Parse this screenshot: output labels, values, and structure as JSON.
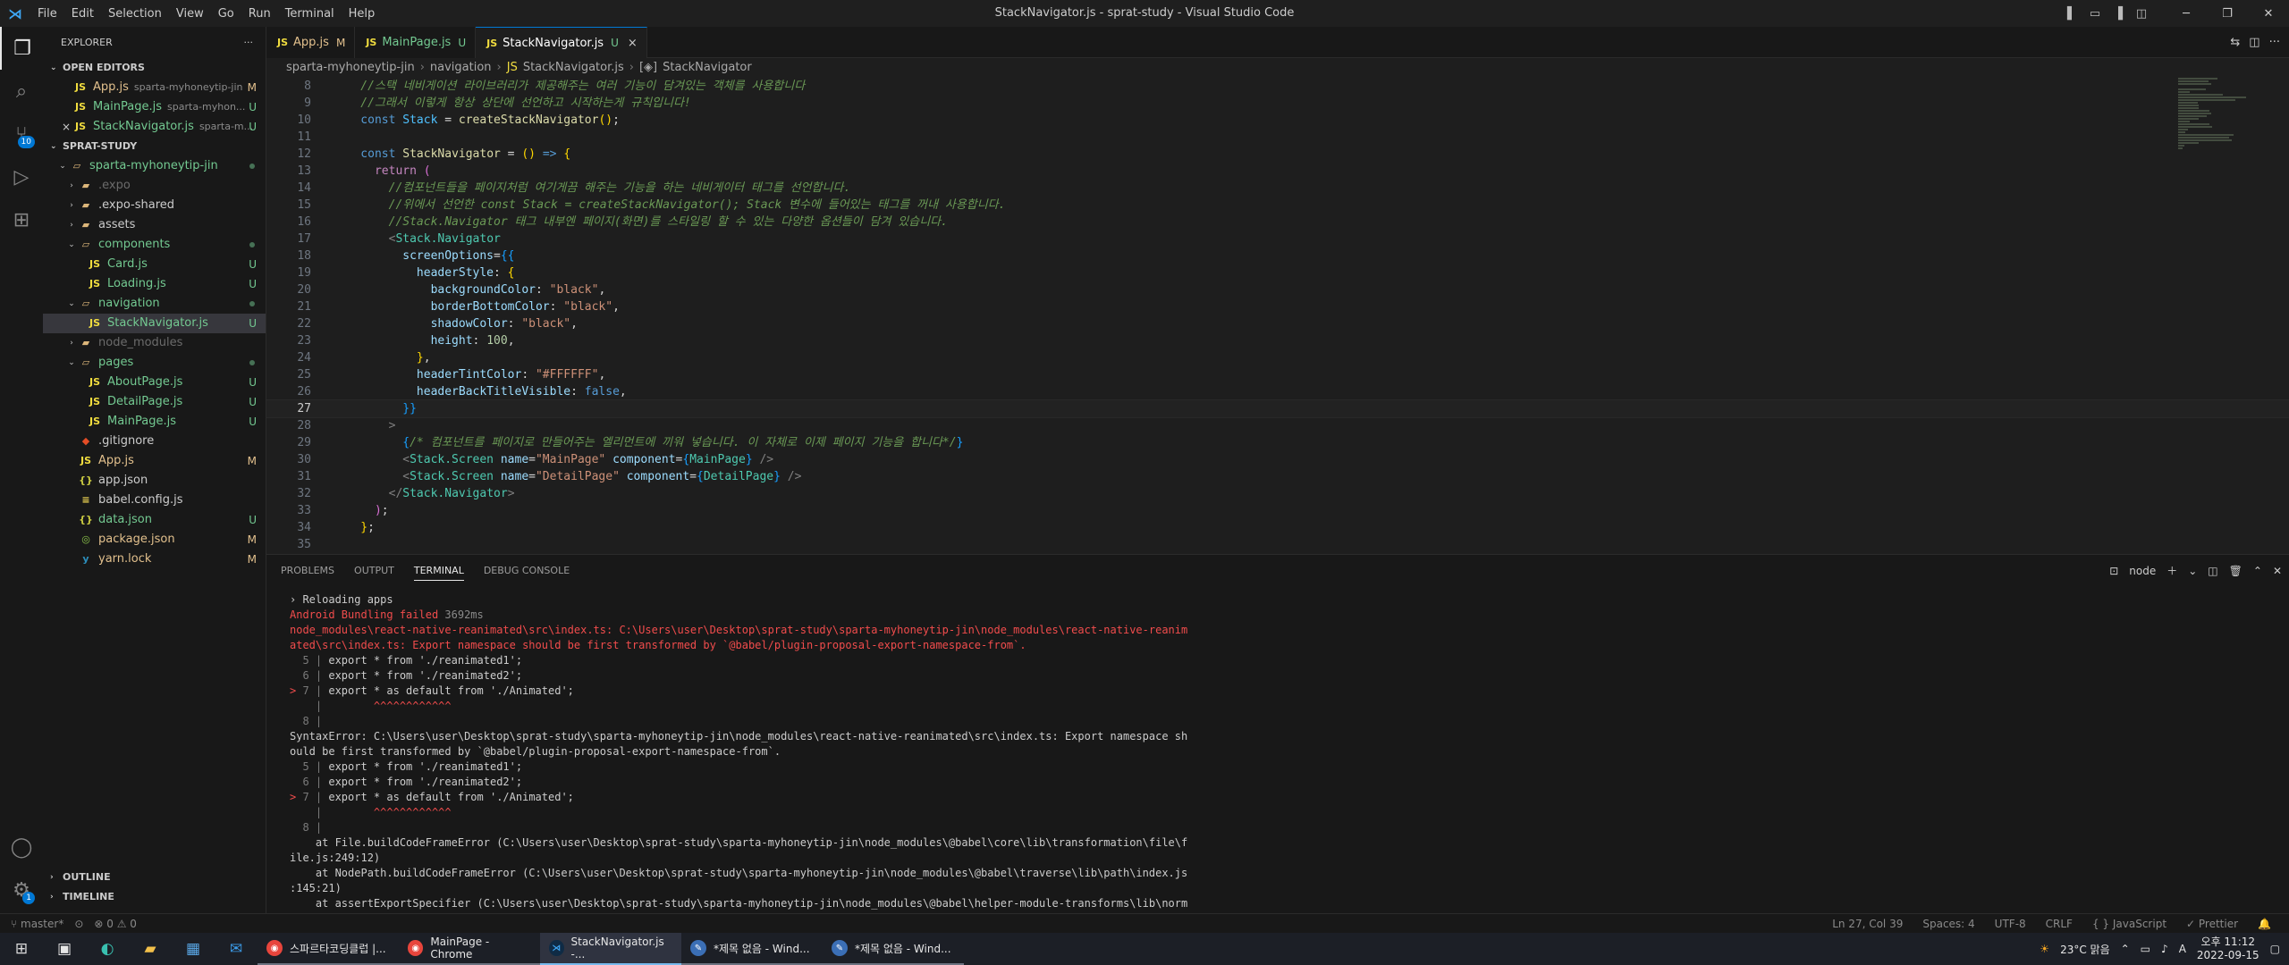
{
  "window": {
    "title": "StackNavigator.js - sprat-study - Visual Studio Code",
    "menu": [
      "File",
      "Edit",
      "Selection",
      "View",
      "Go",
      "Run",
      "Terminal",
      "Help"
    ]
  },
  "activity_bar": {
    "scm_badge": "10",
    "settings_badge": "1"
  },
  "explorer": {
    "title": "EXPLORER",
    "open_editors_label": "OPEN EDITORS",
    "open_editors": [
      {
        "name": "App.js",
        "desc": "sparta-myhoneytip-jin",
        "status": "M"
      },
      {
        "name": "MainPage.js",
        "desc": "sparta-myhon...",
        "status": "U"
      },
      {
        "name": "StackNavigator.js",
        "desc": "sparta-m...",
        "status": "U",
        "close": "×"
      }
    ],
    "workspace_label": "SPRAT-STUDY",
    "tree": [
      {
        "name": "sparta-myhoneytip-jin",
        "type": "folder-open",
        "depth": 1
      },
      {
        "name": ".expo",
        "type": "folder",
        "depth": 2,
        "dim": true
      },
      {
        "name": ".expo-shared",
        "type": "folder",
        "depth": 2
      },
      {
        "name": "assets",
        "type": "folder",
        "depth": 2
      },
      {
        "name": "components",
        "type": "folder-open",
        "depth": 2,
        "git": "u"
      },
      {
        "name": "Card.js",
        "type": "js",
        "depth": 3,
        "status": "U"
      },
      {
        "name": "Loading.js",
        "type": "js",
        "depth": 3,
        "status": "U"
      },
      {
        "name": "navigation",
        "type": "folder-open",
        "depth": 2
      },
      {
        "name": "StackNavigator.js",
        "type": "js",
        "depth": 3,
        "status": "U",
        "active": true
      },
      {
        "name": "node_modules",
        "type": "folder",
        "depth": 2,
        "dim": true
      },
      {
        "name": "pages",
        "type": "folder-open",
        "depth": 2
      },
      {
        "name": "AboutPage.js",
        "type": "js",
        "depth": 3,
        "status": "U"
      },
      {
        "name": "DetailPage.js",
        "type": "js",
        "depth": 3,
        "status": "U"
      },
      {
        "name": "MainPage.js",
        "type": "js",
        "depth": 3,
        "status": "U"
      },
      {
        "name": ".gitignore",
        "type": "git",
        "depth": 2
      },
      {
        "name": "App.js",
        "type": "js",
        "depth": 2,
        "status": "M"
      },
      {
        "name": "app.json",
        "type": "json",
        "depth": 2
      },
      {
        "name": "babel.config.js",
        "type": "babel",
        "depth": 2
      },
      {
        "name": "data.json",
        "type": "json",
        "depth": 2,
        "status": "U"
      },
      {
        "name": "package.json",
        "type": "pkg",
        "depth": 2,
        "status": "M"
      },
      {
        "name": "yarn.lock",
        "type": "yarn",
        "depth": 2,
        "status": "M"
      }
    ],
    "outline_label": "OUTLINE",
    "timeline_label": "TIMELINE"
  },
  "tabs": [
    {
      "name": "App.js",
      "status": "M"
    },
    {
      "name": "MainPage.js",
      "status": "U"
    },
    {
      "name": "StackNavigator.js",
      "status": "U",
      "active": true,
      "close": "×"
    }
  ],
  "breadcrumb": [
    "sparta-myhoneytip-jin",
    "navigation",
    "StackNavigator.js",
    "StackNavigator"
  ],
  "code_start_line": 8,
  "cursor_line": 27,
  "code": [
    [
      [
        "cm",
        "    //스택 네비게이션 라이브러리가 제공해주는 여러 기능이 담겨있는 객체를 사용합니다"
      ]
    ],
    [
      [
        "cm",
        "    //그래서 이렇게 항상 상단에 선언하고 시작하는게 규칙입니다!"
      ]
    ],
    [
      [
        "kw",
        "    const "
      ],
      [
        "const",
        "Stack"
      ],
      [
        "p",
        " = "
      ],
      [
        "fn",
        "createStackNavigator"
      ],
      [
        "br",
        "()"
      ],
      [
        "p",
        ";"
      ]
    ],
    [],
    [
      [
        "kw",
        "    const "
      ],
      [
        "fn",
        "StackNavigator"
      ],
      [
        "p",
        " = "
      ],
      [
        "br",
        "()"
      ],
      [
        "kw",
        " =>"
      ],
      [
        "p",
        " "
      ],
      [
        "br",
        "{"
      ]
    ],
    [
      [
        "ctrl",
        "      return"
      ],
      [
        "p",
        " "
      ],
      [
        "br2",
        "("
      ]
    ],
    [
      [
        "cm",
        "        //컴포넌트들을 페이지처럼 여기게끔 해주는 기능을 하는 네비게이터 태그를 선언합니다."
      ]
    ],
    [
      [
        "cm",
        "        //위에서 선언한 const Stack = createStackNavigator(); Stack 변수에 들어있는 태그를 꺼내 사용합니다."
      ]
    ],
    [
      [
        "cm",
        "        //Stack.Navigator 태그 내부엔 페이지(화면)를 스타일링 할 수 있는 다양한 옵션들이 담겨 있습니다."
      ]
    ],
    [
      [
        "tagbr",
        "        <"
      ],
      [
        "tag",
        "Stack.Navigator"
      ]
    ],
    [
      [
        "var",
        "          screenOptions"
      ],
      [
        "p",
        "="
      ],
      [
        "br3",
        "{{"
      ]
    ],
    [
      [
        "var",
        "            headerStyle"
      ],
      [
        "p",
        ": "
      ],
      [
        "br",
        "{"
      ]
    ],
    [
      [
        "var",
        "              backgroundColor"
      ],
      [
        "p",
        ": "
      ],
      [
        "str",
        "\"black\""
      ],
      [
        "p",
        ","
      ]
    ],
    [
      [
        "var",
        "              borderBottomColor"
      ],
      [
        "p",
        ": "
      ],
      [
        "str",
        "\"black\""
      ],
      [
        "p",
        ","
      ]
    ],
    [
      [
        "var",
        "              shadowColor"
      ],
      [
        "p",
        ": "
      ],
      [
        "str",
        "\"black\""
      ],
      [
        "p",
        ","
      ]
    ],
    [
      [
        "var",
        "              height"
      ],
      [
        "p",
        ": "
      ],
      [
        "num",
        "100"
      ],
      [
        "p",
        ","
      ]
    ],
    [
      [
        "br",
        "            }"
      ],
      [
        "p",
        ","
      ]
    ],
    [
      [
        "var",
        "            headerTintColor"
      ],
      [
        "p",
        ": "
      ],
      [
        "str",
        "\"#FFFFFF\""
      ],
      [
        "p",
        ","
      ]
    ],
    [
      [
        "var",
        "            headerBackTitleVisible"
      ],
      [
        "p",
        ": "
      ],
      [
        "kw",
        "false"
      ],
      [
        "p",
        ","
      ]
    ],
    [
      [
        "br3",
        "          }}"
      ]
    ],
    [
      [
        "tagbr",
        "        >"
      ]
    ],
    [
      [
        "p",
        "          "
      ],
      [
        "br3",
        "{"
      ],
      [
        "cm",
        "/* 컴포넌트를 페이지로 만들어주는 엘리먼트에 끼워 넣습니다. 이 자체로 이제 페이지 기능을 합니다*/"
      ],
      [
        "br3",
        "}"
      ]
    ],
    [
      [
        "tagbr",
        "          <"
      ],
      [
        "tag",
        "Stack.Screen"
      ],
      [
        "var",
        " name"
      ],
      [
        "p",
        "="
      ],
      [
        "str",
        "\"MainPage\""
      ],
      [
        "var",
        " component"
      ],
      [
        "p",
        "="
      ],
      [
        "br3",
        "{"
      ],
      [
        "tag",
        "MainPage"
      ],
      [
        "br3",
        "}"
      ],
      [
        "tagbr",
        " />"
      ]
    ],
    [
      [
        "tagbr",
        "          <"
      ],
      [
        "tag",
        "Stack.Screen"
      ],
      [
        "var",
        " name"
      ],
      [
        "p",
        "="
      ],
      [
        "str",
        "\"DetailPage\""
      ],
      [
        "var",
        " component"
      ],
      [
        "p",
        "="
      ],
      [
        "br3",
        "{"
      ],
      [
        "tag",
        "DetailPage"
      ],
      [
        "br3",
        "}"
      ],
      [
        "tagbr",
        " />"
      ]
    ],
    [
      [
        "tagbr",
        "        </"
      ],
      [
        "tag",
        "Stack.Navigator"
      ],
      [
        "tagbr",
        ">"
      ]
    ],
    [
      [
        "br2",
        "      )"
      ],
      [
        "p",
        ";"
      ]
    ],
    [
      [
        "br",
        "    }"
      ],
      [
        "p",
        ";"
      ]
    ],
    []
  ],
  "panel": {
    "tabs": [
      "PROBLEMS",
      "OUTPUT",
      "TERMINAL",
      "DEBUG CONSOLE"
    ],
    "active_tab": "TERMINAL",
    "shell": "node",
    "terminal_lines": [
      [
        [
          "n",
          "› Reloading apps"
        ]
      ],
      [
        [
          "r",
          "Android Bundling failed "
        ],
        [
          "d",
          "3692ms"
        ]
      ],
      [
        [
          "r",
          "node_modules\\react-native-reanimated\\src\\index.ts: C:\\Users\\user\\Desktop\\sprat-study\\sparta-myhoneytip-jin\\node_modules\\react-native-reanim"
        ]
      ],
      [
        [
          "r",
          "ated\\src\\index.ts: Export namespace should be first transformed by `@babel/plugin-proposal-export-namespace-from`."
        ]
      ],
      [
        [
          "g",
          "  5 | "
        ],
        [
          "n",
          "export * from './reanimated1';"
        ]
      ],
      [
        [
          "g",
          "  6 | "
        ],
        [
          "n",
          "export * from './reanimated2';"
        ]
      ],
      [
        [
          "r",
          "> "
        ],
        [
          "g",
          "7 | "
        ],
        [
          "n",
          "export * as default from './Animated';"
        ]
      ],
      [
        [
          "g",
          "    | "
        ],
        [
          "r",
          "       ^^^^^^^^^^^^"
        ]
      ],
      [
        [
          "g",
          "  8 |"
        ]
      ],
      [
        [
          "n",
          "SyntaxError: C:\\Users\\user\\Desktop\\sprat-study\\sparta-myhoneytip-jin\\node_modules\\react-native-reanimated\\src\\index.ts: Export namespace sh"
        ]
      ],
      [
        [
          "n",
          "ould be first transformed by `@babel/plugin-proposal-export-namespace-from`."
        ]
      ],
      [
        [
          "g",
          "  5 | "
        ],
        [
          "n",
          "export * from './reanimated1';"
        ]
      ],
      [
        [
          "g",
          "  6 | "
        ],
        [
          "n",
          "export * from './reanimated2';"
        ]
      ],
      [
        [
          "r",
          "> "
        ],
        [
          "g",
          "7 | "
        ],
        [
          "n",
          "export * as default from './Animated';"
        ]
      ],
      [
        [
          "g",
          "    | "
        ],
        [
          "r",
          "       ^^^^^^^^^^^^"
        ]
      ],
      [
        [
          "g",
          "  8 |"
        ]
      ],
      [
        [
          "n",
          "    at File.buildCodeFrameError (C:\\Users\\user\\Desktop\\sprat-study\\sparta-myhoneytip-jin\\node_modules\\@babel\\core\\lib\\transformation\\file\\f"
        ]
      ],
      [
        [
          "n",
          "ile.js:249:12)"
        ]
      ],
      [
        [
          "n",
          "    at NodePath.buildCodeFrameError (C:\\Users\\user\\Desktop\\sprat-study\\sparta-myhoneytip-jin\\node_modules\\@babel\\traverse\\lib\\path\\index.js"
        ]
      ],
      [
        [
          "n",
          ":145:21)"
        ]
      ],
      [
        [
          "n",
          "    at assertExportSpecifier (C:\\Users\\user\\Desktop\\sprat-study\\sparta-myhoneytip-jin\\node_modules\\@babel\\helper-module-transforms\\lib\\norm"
        ]
      ]
    ]
  },
  "statusbar": {
    "branch": "master*",
    "problems": "⊗ 0 ⚠ 0",
    "right": [
      "Ln 27, Col 39",
      "Spaces: 4",
      "UTF-8",
      "CRLF",
      "{ } JavaScript",
      "✓ Prettier"
    ]
  },
  "taskbar": {
    "apps": [
      {
        "label": "스파르타코딩클럽 |...",
        "icon": "chrome"
      },
      {
        "label": "MainPage - Chrome",
        "icon": "chrome"
      },
      {
        "label": "StackNavigator.js -...",
        "icon": "vscode",
        "active": true
      },
      {
        "label": "*제목 없음 - Wind...",
        "icon": "notepad"
      },
      {
        "label": "*제목 없음 - Wind...",
        "icon": "notepad"
      }
    ],
    "weather": "23°C 맑음",
    "ime": "A",
    "time": "오후 11:12",
    "date": "2022-09-15"
  }
}
